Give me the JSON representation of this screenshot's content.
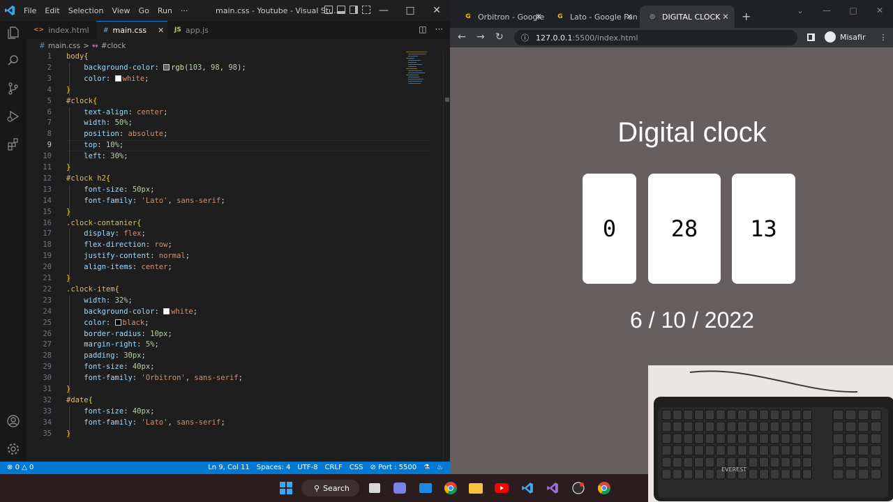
{
  "vscode": {
    "menu": [
      "File",
      "Edit",
      "Selection",
      "View",
      "Go",
      "Run",
      "···"
    ],
    "window_title": "main.css - Youtube - Visual Stu...",
    "tabs": [
      {
        "icon": "<>",
        "label": "index.html",
        "active": false
      },
      {
        "icon": "#",
        "label": "main.css",
        "active": true
      },
      {
        "icon": "JS",
        "label": "app.js",
        "active": false
      }
    ],
    "breadcrumb": {
      "file": "main.css",
      "sep": ">",
      "symbol": "#clock"
    },
    "status": {
      "errors": "0",
      "warnings": "0",
      "position": "Ln 9, Col 11",
      "spaces": "Spaces: 4",
      "encoding": "UTF-8",
      "eol": "CRLF",
      "language": "CSS",
      "port": "Port : 5500"
    },
    "accent": "#0078d4"
  },
  "code_lines": [
    [
      [
        "sel",
        "body"
      ],
      [
        "brace",
        "{"
      ]
    ],
    [
      [
        "pad",
        "    "
      ],
      [
        "prop",
        "background-color"
      ],
      [
        "punc",
        ": "
      ],
      [
        "swatch",
        "#676262"
      ],
      [
        "fn",
        "rgb"
      ],
      [
        "punc",
        "("
      ],
      [
        "num",
        "103"
      ],
      [
        "punc",
        ", "
      ],
      [
        "num",
        "98"
      ],
      [
        "punc",
        ", "
      ],
      [
        "num",
        "98"
      ],
      [
        "punc",
        ");"
      ]
    ],
    [
      [
        "pad",
        "    "
      ],
      [
        "prop",
        "color"
      ],
      [
        "punc",
        ": "
      ],
      [
        "swatch",
        "#ffffff"
      ],
      [
        "val",
        "white"
      ],
      [
        "punc",
        ";"
      ]
    ],
    [
      [
        "brace",
        "}"
      ]
    ],
    [
      [
        "sel",
        "#clock"
      ],
      [
        "brace",
        "{"
      ]
    ],
    [
      [
        "pad",
        "    "
      ],
      [
        "prop",
        "text-align"
      ],
      [
        "punc",
        ": "
      ],
      [
        "val",
        "center"
      ],
      [
        "punc",
        ";"
      ]
    ],
    [
      [
        "pad",
        "    "
      ],
      [
        "prop",
        "width"
      ],
      [
        "punc",
        ": "
      ],
      [
        "num",
        "50%"
      ],
      [
        "punc",
        ";"
      ]
    ],
    [
      [
        "pad",
        "    "
      ],
      [
        "prop",
        "position"
      ],
      [
        "punc",
        ": "
      ],
      [
        "val",
        "absolute"
      ],
      [
        "punc",
        ";"
      ]
    ],
    [
      [
        "pad",
        "    "
      ],
      [
        "prop",
        "top"
      ],
      [
        "punc",
        ": "
      ],
      [
        "num",
        "10%"
      ],
      [
        "punc",
        ";"
      ]
    ],
    [
      [
        "pad",
        "    "
      ],
      [
        "prop",
        "left"
      ],
      [
        "punc",
        ": "
      ],
      [
        "num",
        "30%"
      ],
      [
        "punc",
        ";"
      ]
    ],
    [
      [
        "brace",
        "}"
      ]
    ],
    [
      [
        "sel",
        "#clock h2"
      ],
      [
        "brace",
        "{"
      ]
    ],
    [
      [
        "pad",
        "    "
      ],
      [
        "prop",
        "font-size"
      ],
      [
        "punc",
        ": "
      ],
      [
        "num",
        "50px"
      ],
      [
        "punc",
        ";"
      ]
    ],
    [
      [
        "pad",
        "    "
      ],
      [
        "prop",
        "font-family"
      ],
      [
        "punc",
        ": "
      ],
      [
        "val",
        "'Lato'"
      ],
      [
        "punc",
        ", "
      ],
      [
        "val",
        "sans-serif"
      ],
      [
        "punc",
        ";"
      ]
    ],
    [
      [
        "brace",
        "}"
      ]
    ],
    [
      [
        "sel",
        ".clock-contanier"
      ],
      [
        "brace",
        "{"
      ]
    ],
    [
      [
        "pad",
        "    "
      ],
      [
        "prop",
        "display"
      ],
      [
        "punc",
        ": "
      ],
      [
        "val",
        "flex"
      ],
      [
        "punc",
        ";"
      ]
    ],
    [
      [
        "pad",
        "    "
      ],
      [
        "prop",
        "flex-direction"
      ],
      [
        "punc",
        ": "
      ],
      [
        "val",
        "row"
      ],
      [
        "punc",
        ";"
      ]
    ],
    [
      [
        "pad",
        "    "
      ],
      [
        "prop",
        "justify-content"
      ],
      [
        "punc",
        ": "
      ],
      [
        "val",
        "normal"
      ],
      [
        "punc",
        ";"
      ]
    ],
    [
      [
        "pad",
        "    "
      ],
      [
        "prop",
        "align-items"
      ],
      [
        "punc",
        ": "
      ],
      [
        "val",
        "center"
      ],
      [
        "punc",
        ";"
      ]
    ],
    [
      [
        "brace",
        "}"
      ]
    ],
    [
      [
        "sel",
        ".clock-item"
      ],
      [
        "brace",
        "{"
      ]
    ],
    [
      [
        "pad",
        "    "
      ],
      [
        "prop",
        "width"
      ],
      [
        "punc",
        ": "
      ],
      [
        "num",
        "32%"
      ],
      [
        "punc",
        ";"
      ]
    ],
    [
      [
        "pad",
        "    "
      ],
      [
        "prop",
        "background-color"
      ],
      [
        "punc",
        ": "
      ],
      [
        "swatch",
        "#ffffff"
      ],
      [
        "val",
        "white"
      ],
      [
        "punc",
        ";"
      ]
    ],
    [
      [
        "pad",
        "    "
      ],
      [
        "prop",
        "color"
      ],
      [
        "punc",
        ": "
      ],
      [
        "swatch",
        "#000000"
      ],
      [
        "val",
        "black"
      ],
      [
        "punc",
        ";"
      ]
    ],
    [
      [
        "pad",
        "    "
      ],
      [
        "prop",
        "border-radius"
      ],
      [
        "punc",
        ": "
      ],
      [
        "num",
        "10px"
      ],
      [
        "punc",
        ";"
      ]
    ],
    [
      [
        "pad",
        "    "
      ],
      [
        "prop",
        "margin-right"
      ],
      [
        "punc",
        ": "
      ],
      [
        "num",
        "5%"
      ],
      [
        "punc",
        ";"
      ]
    ],
    [
      [
        "pad",
        "    "
      ],
      [
        "prop",
        "padding"
      ],
      [
        "punc",
        ": "
      ],
      [
        "num",
        "30px"
      ],
      [
        "punc",
        ";"
      ]
    ],
    [
      [
        "pad",
        "    "
      ],
      [
        "prop",
        "font-size"
      ],
      [
        "punc",
        ": "
      ],
      [
        "num",
        "40px"
      ],
      [
        "punc",
        ";"
      ]
    ],
    [
      [
        "pad",
        "    "
      ],
      [
        "prop",
        "font-family"
      ],
      [
        "punc",
        ": "
      ],
      [
        "val",
        "'Orbitron'"
      ],
      [
        "punc",
        ", "
      ],
      [
        "val",
        "sans-serif"
      ],
      [
        "punc",
        ";"
      ]
    ],
    [
      [
        "brace",
        "}"
      ]
    ],
    [
      [
        "sel",
        "#date"
      ],
      [
        "brace",
        "{"
      ]
    ],
    [
      [
        "pad",
        "    "
      ],
      [
        "prop",
        "font-size"
      ],
      [
        "punc",
        ": "
      ],
      [
        "num",
        "40px"
      ],
      [
        "punc",
        ";"
      ]
    ],
    [
      [
        "pad",
        "    "
      ],
      [
        "prop",
        "font-family"
      ],
      [
        "punc",
        ": "
      ],
      [
        "val",
        "'Lato'"
      ],
      [
        "punc",
        ", "
      ],
      [
        "val",
        "sans-serif"
      ],
      [
        "punc",
        ";"
      ]
    ],
    [
      [
        "brace",
        "}"
      ]
    ]
  ],
  "browser": {
    "tabs": [
      {
        "label": "Orbitron - Google",
        "active": false
      },
      {
        "label": "Lato - Google Fon",
        "active": false
      },
      {
        "label": "DIGITAL CLOCK",
        "active": true
      }
    ],
    "url_host": "127.0.0.1",
    "url_path": ":5500/index.html",
    "profile_name": "Misafir",
    "page_bg": "#665f5f"
  },
  "clock_page": {
    "title": "Digital clock",
    "hours": "0",
    "minutes": "28",
    "seconds": "13",
    "date": "6 / 10 / 2022"
  },
  "taskbar": {
    "search_label": "Search",
    "icons": [
      "windows-start-icon",
      "search-icon",
      "file-explorer-mini-icon",
      "teams-icon",
      "mail-icon",
      "chrome-icon",
      "folder-icon",
      "youtube-icon",
      "vscode-icon",
      "visual-studio-icon",
      "obs-icon",
      "chrome-icon"
    ]
  },
  "webcam": {
    "keyboard_brand": "EVEREST"
  }
}
